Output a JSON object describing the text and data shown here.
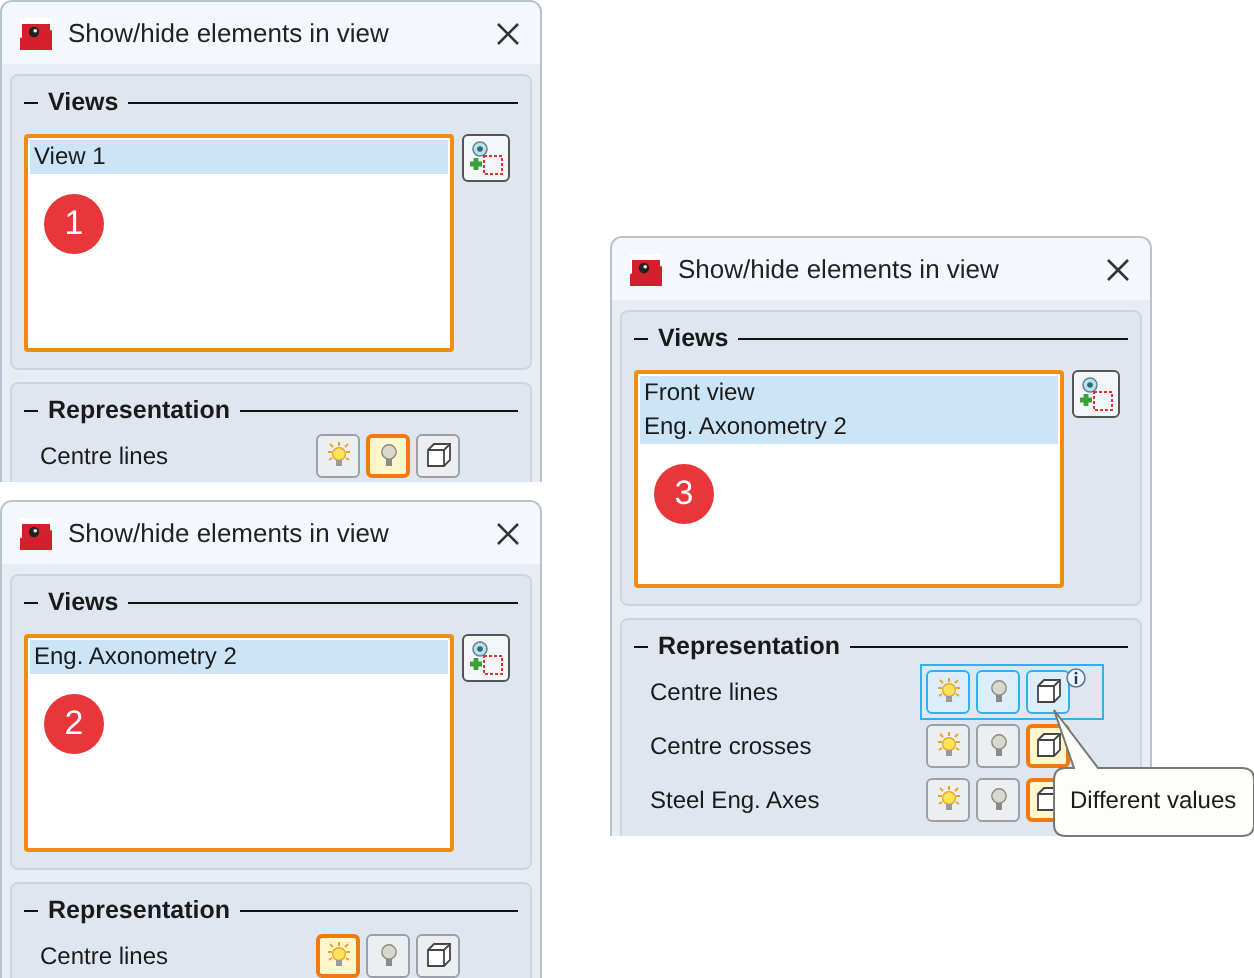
{
  "dialogs": [
    {
      "title": "Show/hide elements in view",
      "views_heading": "Views",
      "views": [
        {
          "label": "View 1",
          "selected": true
        }
      ],
      "badge": "1",
      "representation_heading": "Representation",
      "rows": [
        {
          "label": "Centre lines",
          "mixed": false,
          "buttons": [
            {
              "kind": "bulb-on",
              "selected": false
            },
            {
              "kind": "bulb-off",
              "selected": true
            },
            {
              "kind": "cube",
              "selected": false
            }
          ]
        }
      ]
    },
    {
      "title": "Show/hide elements in view",
      "views_heading": "Views",
      "views": [
        {
          "label": "Eng. Axonometry 2",
          "selected": true
        }
      ],
      "badge": "2",
      "representation_heading": "Representation",
      "rows": [
        {
          "label": "Centre lines",
          "mixed": false,
          "buttons": [
            {
              "kind": "bulb-on",
              "selected": true
            },
            {
              "kind": "bulb-off",
              "selected": false
            },
            {
              "kind": "cube",
              "selected": false
            }
          ]
        }
      ]
    },
    {
      "title": "Show/hide elements in view",
      "views_heading": "Views",
      "views": [
        {
          "label": "Front view",
          "selected": true
        },
        {
          "label": "Eng. Axonometry 2",
          "selected": true
        }
      ],
      "badge": "3",
      "representation_heading": "Representation",
      "rows": [
        {
          "label": "Centre lines",
          "mixed": true,
          "buttons": [
            {
              "kind": "bulb-on",
              "selected": false
            },
            {
              "kind": "bulb-off",
              "selected": false
            },
            {
              "kind": "cube",
              "selected": false
            }
          ]
        },
        {
          "label": "Centre crosses",
          "mixed": false,
          "buttons": [
            {
              "kind": "bulb-on",
              "selected": false
            },
            {
              "kind": "bulb-off",
              "selected": false
            },
            {
              "kind": "cube",
              "selected": true
            }
          ]
        },
        {
          "label": "Steel Eng. Axes",
          "mixed": false,
          "buttons": [
            {
              "kind": "bulb-on",
              "selected": false
            },
            {
              "kind": "bulb-off",
              "selected": false
            },
            {
              "kind": "cube",
              "selected": true
            }
          ]
        }
      ],
      "tooltip": "Different values"
    }
  ]
}
